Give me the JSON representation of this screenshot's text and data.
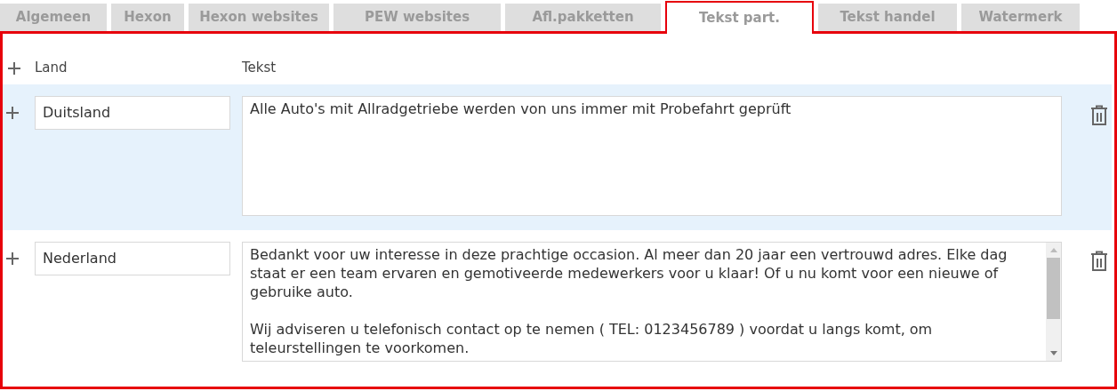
{
  "tabs": [
    {
      "label": "Algemeen",
      "selected": false
    },
    {
      "label": "Hexon",
      "selected": false
    },
    {
      "label": "Hexon websites",
      "selected": false
    },
    {
      "label": "PEW websites",
      "selected": false
    },
    {
      "label": "Afl.pakketten",
      "selected": false
    },
    {
      "label": "Tekst part.",
      "selected": true
    },
    {
      "label": "Tekst handel",
      "selected": false
    },
    {
      "label": "Watermerk",
      "selected": false
    }
  ],
  "table": {
    "columns": [
      "Land",
      "Tekst"
    ],
    "rows": [
      {
        "land": "Duitsland",
        "tekst": "Alle Auto's mit Allradgetriebe werden von uns immer mit Probefahrt geprüft",
        "selected": true,
        "scrollbar": false
      },
      {
        "land": "Nederland",
        "tekst": "Bedankt voor uw interesse in deze prachtige occasion. Al meer dan 20 jaar een vertrouwd adres. Elke dag staat er een team ervaren en gemotiveerde medewerkers voor u klaar! Of u nu komt voor een nieuwe of gebruike auto.\n\nWij adviseren u telefonisch contact op te nemen ( TEL: 0123456789 ) voordat u langs komt, om teleurstellingen te voorkomen.",
        "selected": false,
        "scrollbar": true
      }
    ]
  }
}
